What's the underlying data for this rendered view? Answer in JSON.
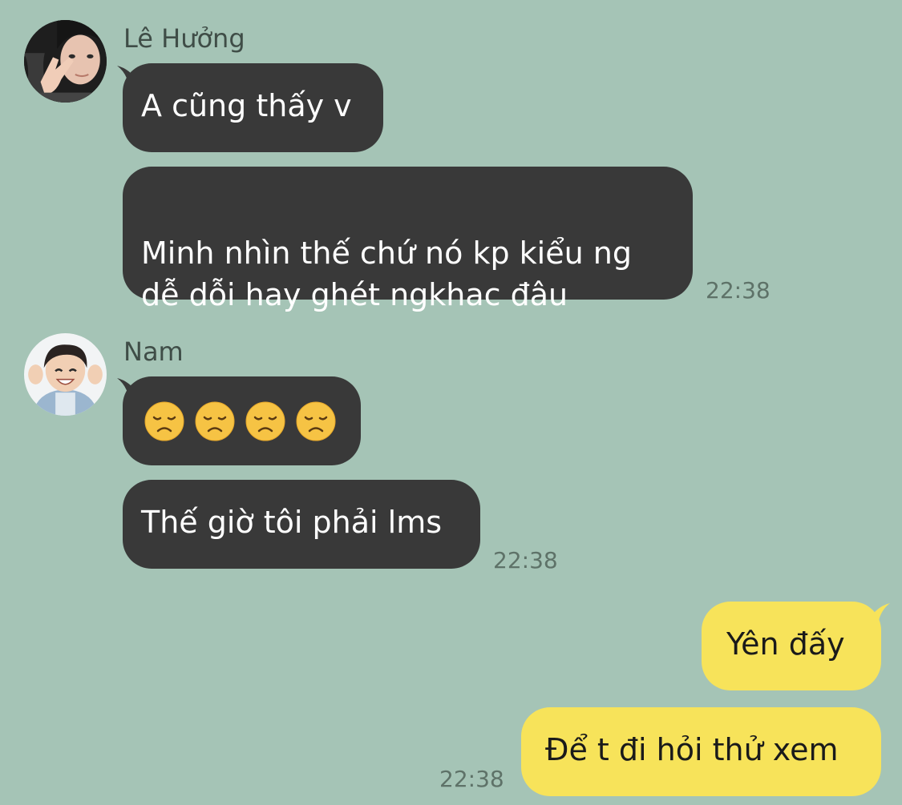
{
  "colors": {
    "background": "#a5c4b6",
    "incoming_bubble": "#393939",
    "outgoing_bubble": "#f7e35a"
  },
  "conversation": {
    "group1": {
      "sender": "Lê Hưởng",
      "avatar_icon": "user-avatar-photo",
      "messages": [
        "A cũng thấy v",
        "Minh nhìn thế chứ nó kp kiểu ng\ndễ dỗi hay ghét ngkhac đâu"
      ],
      "time": "22:38"
    },
    "group2": {
      "sender": "Nam",
      "avatar_icon": "user-avatar-photo",
      "emoji_message": [
        "😞",
        "😞",
        "😞",
        "😞"
      ],
      "emoji_icon": "disappointed-face-emoji",
      "message": "Thế giờ tôi phải lms",
      "time": "22:38"
    },
    "outgoing": {
      "messages": [
        "Yên đấy",
        "Để t đi hỏi thử xem"
      ],
      "time": "22:38"
    }
  }
}
